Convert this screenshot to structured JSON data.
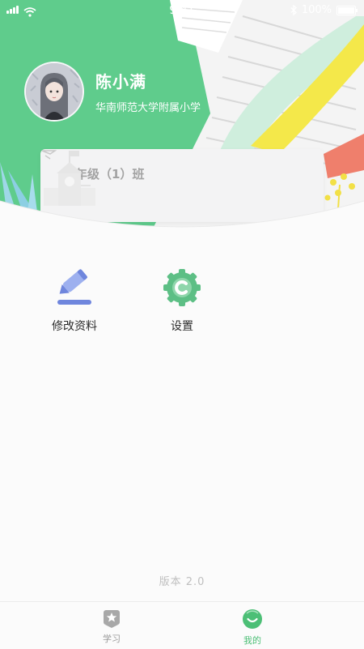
{
  "status_bar": {
    "time": "9:41",
    "battery_text": "100%"
  },
  "profile": {
    "name": "陈小满",
    "school": "华南师范大学附属小学"
  },
  "class_card": {
    "class_name": "五年级（1）班"
  },
  "actions": [
    {
      "label": "修改资料",
      "icon": "pencil-icon",
      "color": "#6f86dd"
    },
    {
      "label": "设置",
      "icon": "gear-icon",
      "color": "#5dbf85"
    }
  ],
  "version": "版本 2.0",
  "tabbar": {
    "tabs": [
      {
        "label": "学习",
        "icon": "star-book-icon",
        "active": false
      },
      {
        "label": "我的",
        "icon": "smile-face-icon",
        "active": true
      }
    ],
    "active_color": "#4cbf76",
    "inactive_color": "#9a9a9a"
  },
  "colors": {
    "header_green": "#5fcc8c",
    "accent_yellow": "#f4e84a",
    "accent_coral": "#ef7f6c"
  }
}
